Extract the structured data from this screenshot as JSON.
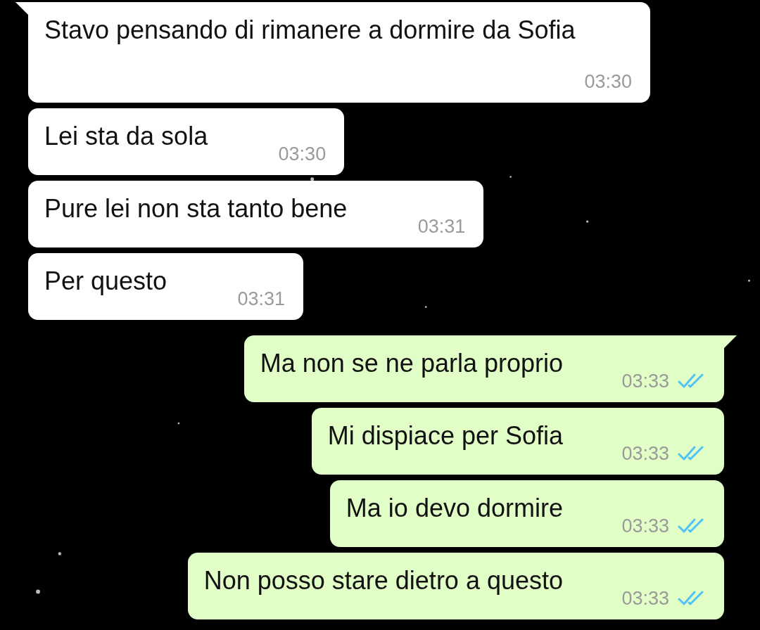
{
  "messages": [
    {
      "kind": "in",
      "tail": true,
      "text": "Stavo pensando di rimanere a dormire da Sofia",
      "time": "03:30"
    },
    {
      "kind": "in",
      "tail": false,
      "text": "Lei sta da sola",
      "time": "03:30"
    },
    {
      "kind": "in",
      "tail": false,
      "text": "Pure lei non sta tanto bene",
      "time": "03:31"
    },
    {
      "kind": "in",
      "tail": false,
      "text": "Per questo",
      "time": "03:31"
    },
    {
      "kind": "out",
      "tail": true,
      "text": "Ma non se ne parla proprio",
      "time": "03:33",
      "read": true
    },
    {
      "kind": "out",
      "tail": false,
      "text": "Mi dispiace per Sofia",
      "time": "03:33",
      "read": true
    },
    {
      "kind": "out",
      "tail": false,
      "text": "Ma io devo dormire",
      "time": "03:33",
      "read": true
    },
    {
      "kind": "out",
      "tail": false,
      "text": "Non posso stare dietro a questo",
      "time": "03:33",
      "read": true
    }
  ]
}
